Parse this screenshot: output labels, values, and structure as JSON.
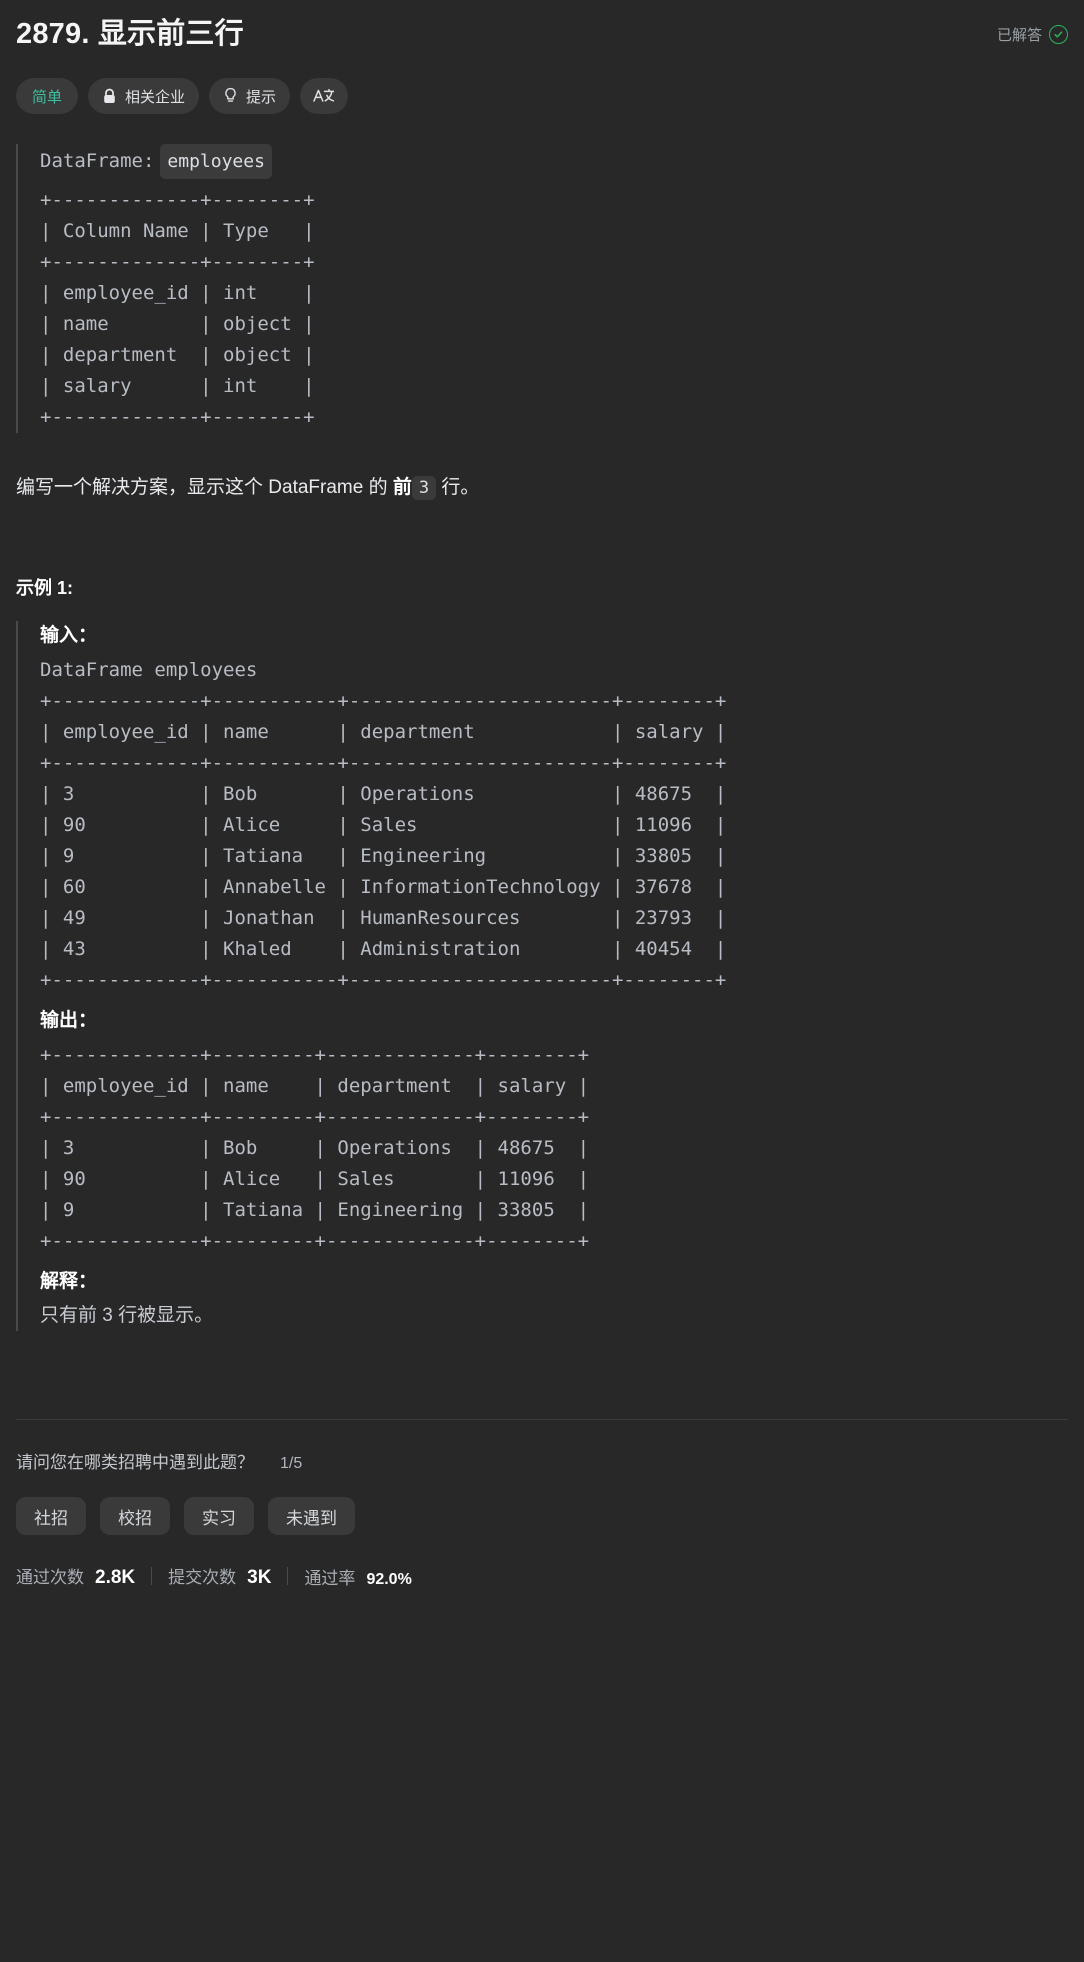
{
  "header": {
    "title": "2879. 显示前三行",
    "solved_label": "已解答",
    "solved_icon": "check-circle-icon",
    "accent_solved": "#2db55d"
  },
  "tags": [
    {
      "label": "简单",
      "icon": null,
      "name": "difficulty-tag",
      "color": "#3fbf9f"
    },
    {
      "label": "相关企业",
      "icon": "lock-icon",
      "name": "related-companies-tag"
    },
    {
      "label": "提示",
      "icon": "lightbulb-icon",
      "name": "hints-tag"
    },
    {
      "label": "",
      "icon": "translate-icon",
      "name": "translate-tag"
    }
  ],
  "schema": {
    "prefix": "DataFrame:",
    "table_name": "employees",
    "table": "+-------------+--------+\n| Column Name | Type   |\n+-------------+--------+\n| employee_id | int    |\n| name        | object |\n| department  | object |\n| salary      | int    |\n+-------------+--------+",
    "columns": [
      {
        "name": "employee_id",
        "type": "int"
      },
      {
        "name": "name",
        "type": "object"
      },
      {
        "name": "department",
        "type": "object"
      },
      {
        "name": "salary",
        "type": "int"
      }
    ]
  },
  "description": {
    "part1": "编写一个解决方案，显示这个 DataFrame 的 ",
    "bold": "前",
    "code": "3",
    "part2": " 行。"
  },
  "example": {
    "title": "示例 1:",
    "input_label": "输入：",
    "input_caption": "DataFrame employees",
    "input_table": "+-------------+-----------+-----------------------+--------+\n| employee_id | name      | department            | salary |\n+-------------+-----------+-----------------------+--------+\n| 3           | Bob       | Operations            | 48675  |\n| 90          | Alice     | Sales                 | 11096  |\n| 9           | Tatiana   | Engineering           | 33805  |\n| 60          | Annabelle | InformationTechnology | 37678  |\n| 49          | Jonathan  | HumanResources        | 23793  |\n| 43          | Khaled    | Administration        | 40454  |\n+-------------+-----------+-----------------------+--------+",
    "output_label": "输出：",
    "output_table": "+-------------+---------+-------------+--------+\n| employee_id | name    | department  | salary |\n+-------------+---------+-------------+--------+\n| 3           | Bob     | Operations  | 48675  |\n| 90          | Alice   | Sales       | 11096  |\n| 9           | Tatiana | Engineering | 33805  |\n+-------------+---------+-------------+--------+",
    "explanation_label": "解释：",
    "explanation_text": "只有前 3 行被显示。",
    "input_rows": [
      {
        "employee_id": "3",
        "name": "Bob",
        "department": "Operations",
        "salary": "48675"
      },
      {
        "employee_id": "90",
        "name": "Alice",
        "department": "Sales",
        "salary": "11096"
      },
      {
        "employee_id": "9",
        "name": "Tatiana",
        "department": "Engineering",
        "salary": "33805"
      },
      {
        "employee_id": "60",
        "name": "Annabelle",
        "department": "InformationTechnology",
        "salary": "37678"
      },
      {
        "employee_id": "49",
        "name": "Jonathan",
        "department": "HumanResources",
        "salary": "23793"
      },
      {
        "employee_id": "43",
        "name": "Khaled",
        "department": "Administration",
        "salary": "40454"
      }
    ],
    "output_rows": [
      {
        "employee_id": "3",
        "name": "Bob",
        "department": "Operations",
        "salary": "48675"
      },
      {
        "employee_id": "90",
        "name": "Alice",
        "department": "Sales",
        "salary": "11096"
      },
      {
        "employee_id": "9",
        "name": "Tatiana",
        "department": "Engineering",
        "salary": "33805"
      }
    ]
  },
  "survey": {
    "question": "请问您在哪类招聘中遇到此题？",
    "counter": "1/5",
    "options": [
      "社招",
      "校招",
      "实习",
      "未遇到"
    ]
  },
  "stats": [
    {
      "label": "通过次数",
      "value": "2.8K"
    },
    {
      "label": "提交次数",
      "value": "3K"
    },
    {
      "label": "通过率",
      "value": "92.0%"
    }
  ]
}
